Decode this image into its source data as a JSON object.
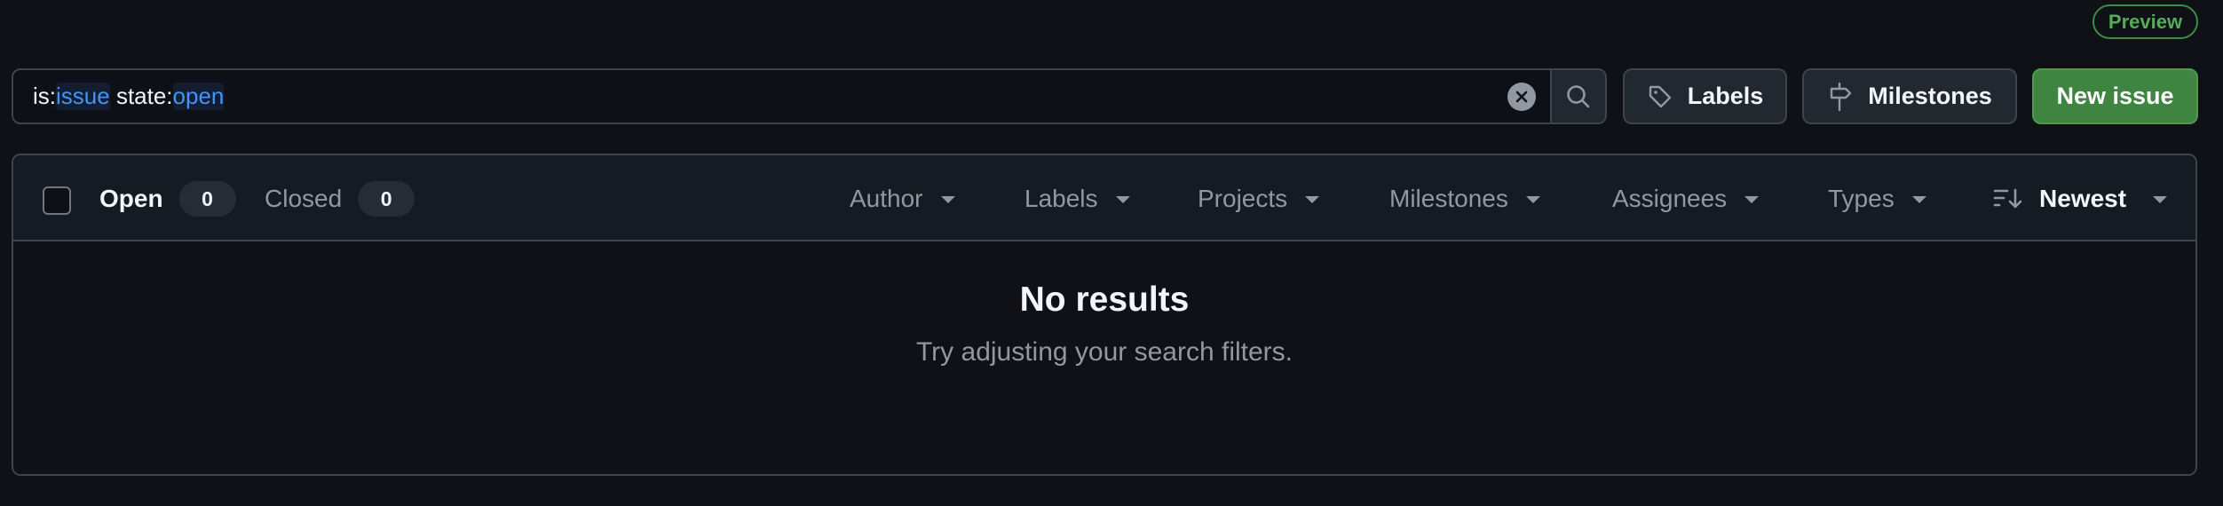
{
  "preview_badge": "Preview",
  "search": {
    "tokens": [
      {
        "key": "is:",
        "value": "issue"
      },
      {
        "key": "state:",
        "value": "open"
      }
    ],
    "clear_icon": "x-circle-fill-icon",
    "search_icon": "search-icon"
  },
  "toolbar": {
    "labels_label": "Labels",
    "labels_icon": "tag-icon",
    "milestones_label": "Milestones",
    "milestones_icon": "milestone-icon",
    "new_issue_label": "New issue"
  },
  "states": {
    "open": {
      "label": "Open",
      "count": "0"
    },
    "closed": {
      "label": "Closed",
      "count": "0"
    }
  },
  "filters": [
    {
      "label": "Author"
    },
    {
      "label": "Labels"
    },
    {
      "label": "Projects"
    },
    {
      "label": "Milestones"
    },
    {
      "label": "Assignees"
    },
    {
      "label": "Types"
    }
  ],
  "sort": {
    "label": "Newest",
    "icon": "sort-desc-icon"
  },
  "empty_state": {
    "title": "No results",
    "subtitle": "Try adjusting your search filters."
  },
  "colors": {
    "accent_green": "#3f8440",
    "link_blue": "#4493f8",
    "badge_green": "#57ab5a"
  }
}
